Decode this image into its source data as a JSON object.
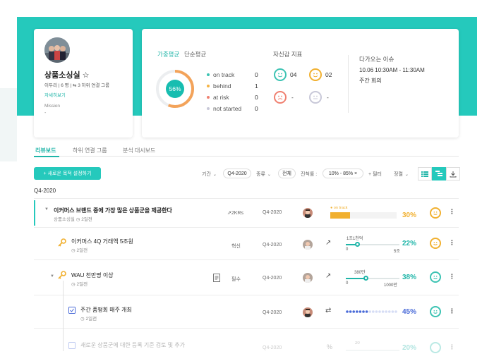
{
  "colors": {
    "accent": "#25c9bc",
    "on_track": "#3cc3b3",
    "behind": "#f5b342",
    "at_risk": "#f08070",
    "not_started": "#c8c8d8",
    "progress_ok": "#1fb5a8",
    "progress_warn": "#f1b02f"
  },
  "profile": {
    "name": "상품소싱실",
    "star": "☆",
    "info": "이두리 | 6 명 | ⇆ 3 하위 연결 그룹",
    "link": "자세히보기",
    "mission_label": "Mission",
    "mission_value": "-"
  },
  "stats": {
    "tabs": [
      "가중평균",
      "단순평균"
    ],
    "gauge_value": "56%",
    "gauge_fraction": 0.56,
    "legend": [
      {
        "label": "on track",
        "value": "0"
      },
      {
        "label": "behind",
        "value": "1"
      },
      {
        "label": "at risk",
        "value": "0"
      },
      {
        "label": "not started",
        "value": "0"
      }
    ],
    "confidence_title": "자신감 지표",
    "confidence": [
      {
        "icon": "happy-face-green-icon",
        "value": "04"
      },
      {
        "icon": "happy-face-yellow-icon",
        "value": "02"
      },
      {
        "icon": "sad-face-red-icon",
        "value": "-"
      },
      {
        "icon": "neutral-face-gray-icon",
        "value": "-"
      }
    ],
    "upcoming_title": "다가오는 이슈",
    "upcoming_time": "10.06 10:30AM - 11:30AM",
    "upcoming_name": "주간 회의"
  },
  "tabs": [
    "리뷰보드",
    "하위 연결 그룹",
    "분석 대시보드"
  ],
  "toolbar": {
    "new_button": "+ 새로운 목적 설정하기",
    "period_label": "기간",
    "period_value": "Q4-2020",
    "type_label": "종류",
    "type_value": "전체",
    "progress_label": "진척률 :",
    "progress_value": "10% - 85% ×",
    "filter_label": "+ 필터",
    "sort_label": "정렬"
  },
  "section_title": "Q4-2020",
  "rows": [
    {
      "title": "이커머스 브랜드 중에 가장 많은 상품군을 제공한다",
      "sub": "상품소싱실",
      "time": "2일전",
      "mid": "2KRs",
      "period": "Q4-2020",
      "status": "on track",
      "pct": "30%",
      "progress": 0.3
    },
    {
      "title": "이커머스 4Q 거래액 5조원",
      "sub": "",
      "time": "2일전",
      "mid": "혁신",
      "period": "Q4-2020",
      "slider_top": "1조1천억",
      "slider_min": "0",
      "slider_max": "5조",
      "pct": "22%",
      "progress": 0.22
    },
    {
      "title": "WAU 천만명 이상",
      "sub": "",
      "time": "2일전",
      "mid": "필수",
      "period": "Q4-2020",
      "slider_top": "380만",
      "slider_min": "0",
      "slider_max": "1000만",
      "pct": "38%",
      "progress": 0.38
    },
    {
      "title": "주간 품평회 매주 개최",
      "sub": "",
      "time": "2일전",
      "mid": "",
      "period": "Q4-2020",
      "pct": "45%",
      "progress": 0.45
    },
    {
      "title": "새로운 상품군에 대한 등록 기준 검토 및 추가",
      "sub": "",
      "time": "",
      "mid": "",
      "period": "Q4-2020",
      "slider_top": "20",
      "pct": "20%",
      "progress": 0.2
    }
  ]
}
